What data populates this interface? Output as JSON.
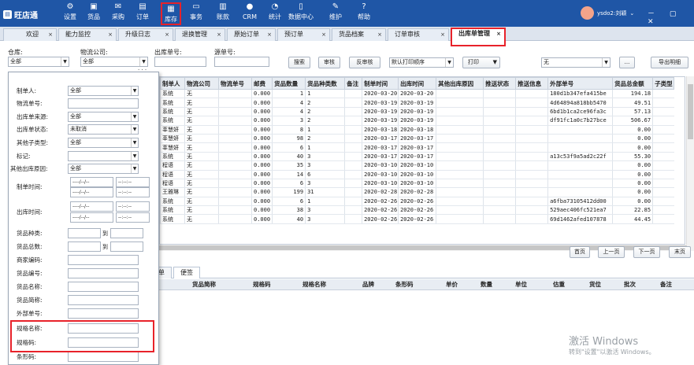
{
  "app": {
    "logo_text": "旺店通"
  },
  "nav": [
    {
      "label": "设置",
      "icon": "⚙"
    },
    {
      "label": "货品",
      "icon": "▣"
    },
    {
      "label": "采购",
      "icon": "✉"
    },
    {
      "label": "订单",
      "icon": "▤"
    },
    {
      "label": "库存",
      "icon": "▦"
    },
    {
      "label": "事务",
      "icon": "▭"
    },
    {
      "label": "账款",
      "icon": "▥"
    },
    {
      "label": "CRM",
      "icon": "●"
    },
    {
      "label": "统计",
      "icon": "◔"
    },
    {
      "label": "数据中心",
      "icon": "▯"
    },
    {
      "label": "维护",
      "icon": "✎"
    },
    {
      "label": "帮助",
      "icon": "?"
    }
  ],
  "user": {
    "name": "ysdo2:刘颖",
    "caret": "⌄"
  },
  "window_controls": "－ ▢ ✕",
  "tabs": [
    {
      "label": "欢迎"
    },
    {
      "label": "能力监控"
    },
    {
      "label": "升级日志"
    },
    {
      "label": "退换管理"
    },
    {
      "label": "原始订单"
    },
    {
      "label": "预订单"
    },
    {
      "label": "货品档案"
    },
    {
      "label": "订单审核"
    },
    {
      "label": "出库单管理"
    }
  ],
  "tab_close": "×",
  "filters": {
    "warehouse_label": "仓库:",
    "warehouse_value": "全部",
    "logistics_label": "物流公司:",
    "logistics_value": "全部",
    "outbound_no_label": "出库单号:",
    "source_no_label": "源单号:",
    "more": "· · ·"
  },
  "toolbar": {
    "search": "搜索",
    "audit": "审核",
    "unaudit": "反审核",
    "print_order": "默认打印顺序",
    "print": "打印",
    "template_value": "无",
    "ellipsis": "...",
    "export": "导出明细"
  },
  "panel": {
    "creator_label": "制单人:",
    "creator_value": "全部",
    "tracking_label": "物流单号:",
    "source_label": "出库单来源:",
    "source_value": "全部",
    "status_label": "出库单状态:",
    "status_value": "未取消",
    "other_type_label": "其他子类型:",
    "other_type_value": "全部",
    "mark_label": "标记:",
    "reason_label": "其他出库原因:",
    "reason_value": "全部",
    "create_time_label": "制单时间:",
    "out_time_label": "出库时间:",
    "date_placeholder": "----/--/--",
    "time_placeholder": "--:--:--",
    "to": "到",
    "kinds_label": "货品种类:",
    "total_label": "货品总数:",
    "merchant_code_label": "商家编码:",
    "goods_no_label": "货品编号:",
    "goods_name_label": "货品名称:",
    "goods_short_label": "货品简称:",
    "ext_no_label": "外部单号:",
    "spec_name_label": "规格名称:",
    "spec_code_label": "规格码:",
    "barcode_label": "条形码:"
  },
  "grid": {
    "columns": [
      "制单人",
      "物流公司",
      "物流单号",
      "邮费",
      "货品数量",
      "货品种类数",
      "备注",
      "制单时间",
      "出库时间",
      "其他出库原因",
      "推送状态",
      "推送信息",
      "外部单号",
      "货品总金额",
      "子类型"
    ],
    "rows": [
      [
        "系统",
        "无",
        "",
        "0.000",
        "1",
        "1",
        "",
        "2020-03-20",
        "2020-03-20",
        "",
        "",
        "",
        "180d1b347efa415be",
        "194.18",
        ""
      ],
      [
        "系统",
        "无",
        "",
        "0.000",
        "4",
        "2",
        "",
        "2020-03-19",
        "2020-03-19",
        "",
        "",
        "",
        "4d64894a818bb5470",
        "49.51",
        ""
      ],
      [
        "系统",
        "无",
        "",
        "0.000",
        "4",
        "2",
        "",
        "2020-03-19",
        "2020-03-19",
        "",
        "",
        "",
        "6bd1b1ca2ce96fa3c",
        "57.13",
        ""
      ],
      [
        "系统",
        "无",
        "",
        "0.000",
        "3",
        "2",
        "",
        "2020-03-19",
        "2020-03-19",
        "",
        "",
        "",
        "df91fc1a0c7b27bce",
        "506.67",
        ""
      ],
      [
        "莘慧妍",
        "无",
        "",
        "0.000",
        "8",
        "1",
        "",
        "2020-03-18",
        "2020-03-18",
        "",
        "",
        "",
        "",
        "0.00",
        ""
      ],
      [
        "莘慧妍",
        "无",
        "",
        "0.000",
        "98",
        "2",
        "",
        "2020-03-17",
        "2020-03-17",
        "",
        "",
        "",
        "",
        "0.00",
        ""
      ],
      [
        "莘慧妍",
        "无",
        "",
        "0.000",
        "6",
        "1",
        "",
        "2020-03-17",
        "2020-03-17",
        "",
        "",
        "",
        "",
        "0.00",
        ""
      ],
      [
        "系统",
        "无",
        "",
        "0.000",
        "40",
        "3",
        "",
        "2020-03-17",
        "2020-03-17",
        "",
        "",
        "",
        "a13c53f9a5ad2c22f",
        "55.30",
        ""
      ],
      [
        "程语",
        "无",
        "",
        "0.000",
        "35",
        "3",
        "",
        "2020-03-10",
        "2020-03-10",
        "",
        "",
        "",
        "",
        "0.00",
        ""
      ],
      [
        "程语",
        "无",
        "",
        "0.000",
        "14",
        "6",
        "",
        "2020-03-10",
        "2020-03-10",
        "",
        "",
        "",
        "",
        "0.00",
        ""
      ],
      [
        "程语",
        "无",
        "",
        "0.000",
        "6",
        "3",
        "",
        "2020-03-10",
        "2020-03-10",
        "",
        "",
        "",
        "",
        "0.00",
        ""
      ],
      [
        "王雅琳",
        "无",
        "",
        "0.000",
        "199",
        "31",
        "",
        "2020-02-28",
        "2020-02-28",
        "",
        "",
        "",
        "",
        "0.00",
        ""
      ],
      [
        "系统",
        "无",
        "",
        "0.000",
        "6",
        "1",
        "",
        "2020-02-26",
        "2020-02-26",
        "",
        "",
        "",
        "a6fba73105412dd00",
        "0.00",
        ""
      ],
      [
        "系统",
        "无",
        "",
        "0.000",
        "38",
        "3",
        "",
        "2020-02-26",
        "2020-02-26",
        "",
        "",
        "",
        "529aec406fc521ea7",
        "22.85",
        ""
      ],
      [
        "系统",
        "无",
        "",
        "0.000",
        "40",
        "3",
        "",
        "2020-02-26",
        "2020-02-26",
        "",
        "",
        "",
        "69d1462afed107878",
        "44.45",
        ""
      ]
    ]
  },
  "pager": {
    "first": "首页",
    "prev": "上一页",
    "next": "下一页",
    "last": "末页"
  },
  "subtabs": [
    {
      "label": "单"
    },
    {
      "label": "便签"
    }
  ],
  "subgrid_columns": [
    "货品简称",
    "规格码",
    "规格名称",
    "品牌",
    "条形码",
    "单价",
    "数量",
    "单位",
    "估重",
    "货位",
    "批次",
    "备注"
  ],
  "watermark": {
    "line1": "激活 Windows",
    "line2": "转到\"设置\"以激活 Windows。"
  }
}
